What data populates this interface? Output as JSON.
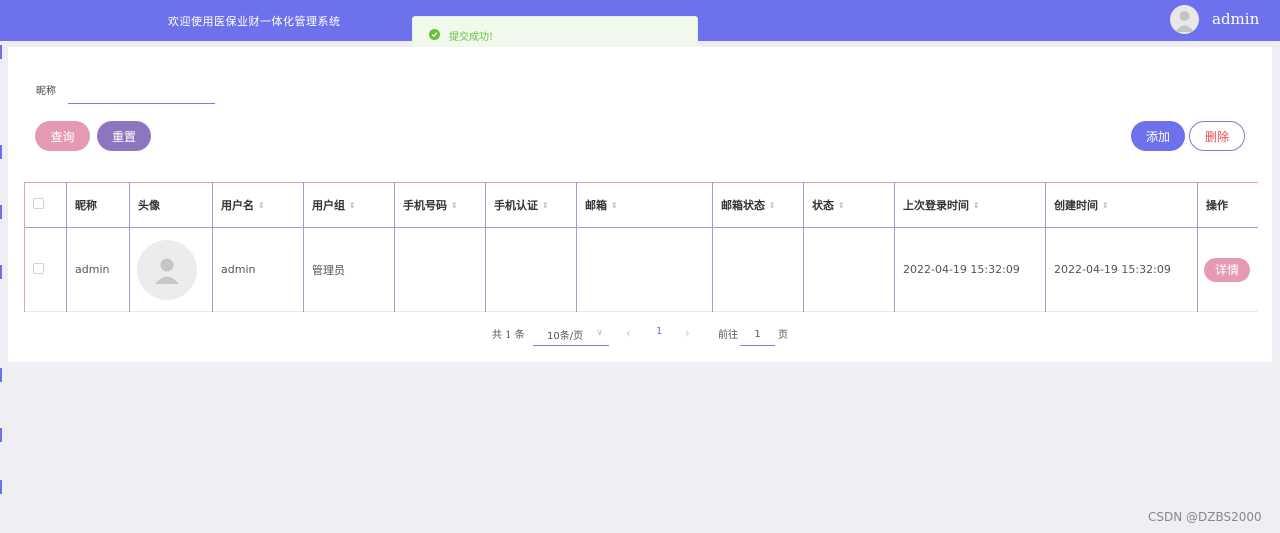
{
  "header": {
    "title": "欢迎使用医保业财一体化管理系统",
    "username": "admin",
    "avatar_icon": "user-avatar-icon"
  },
  "toast": {
    "message": "提交成功!",
    "icon": "check-circle-icon",
    "color": "#67c23a"
  },
  "search": {
    "label": "昵称",
    "value": "",
    "query_label": "查询",
    "reset_label": "重置"
  },
  "actions": {
    "add_label": "添加",
    "delete_label": "删除"
  },
  "table": {
    "headers": {
      "nickname": "昵称",
      "avatar": "头像",
      "username": "用户名",
      "group": "用户组",
      "phone": "手机号码",
      "phone_verified": "手机认证",
      "email": "邮箱",
      "email_status": "邮箱状态",
      "status": "状态",
      "last_login": "上次登录时间",
      "created": "创建时间",
      "operation": "操作"
    },
    "rows": [
      {
        "nickname": "admin",
        "username": "admin",
        "group": "管理员",
        "phone": "",
        "phone_verified": "",
        "email": "",
        "email_status": "",
        "status": "",
        "last_login": "2022-04-19 15:32:09",
        "created": "2022-04-19 15:32:09",
        "detail_label": "详情"
      }
    ]
  },
  "pagination": {
    "total": "共 1 条",
    "page_size": "10条/页",
    "current_page": "1",
    "goto_label": "前往",
    "goto_value": "1",
    "page_unit": "页"
  },
  "watermark": "CSDN @DZBS2000",
  "colors": {
    "primary": "#6d71ec",
    "pink": "#e49ab1",
    "purple": "#8d76bf",
    "danger": "#e24d4d"
  }
}
